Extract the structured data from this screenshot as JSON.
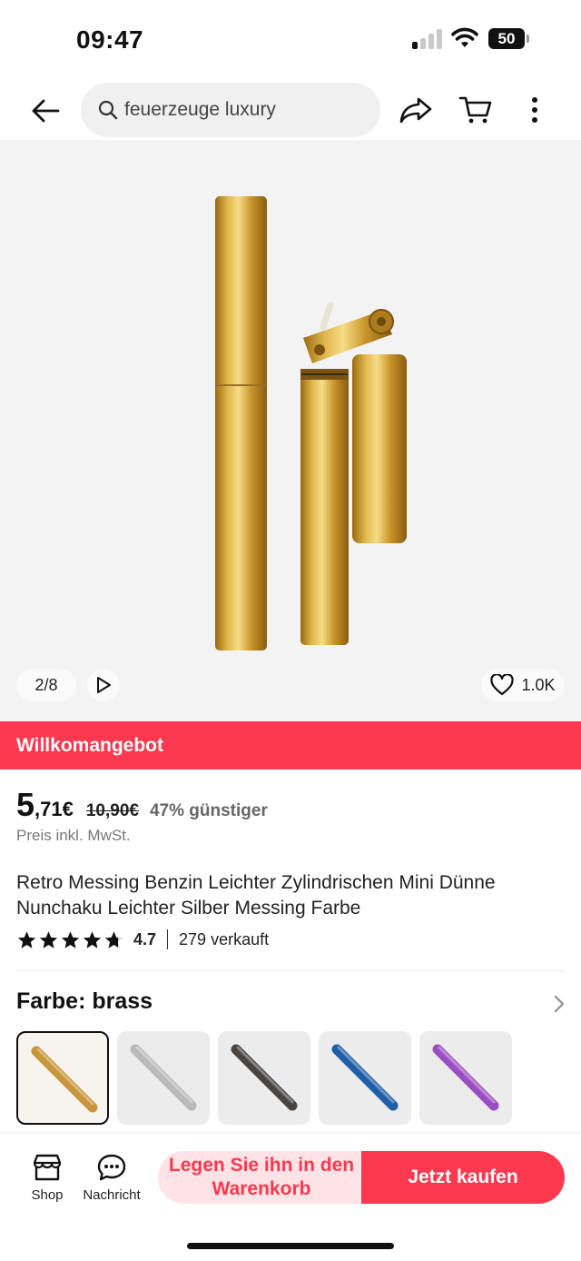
{
  "status_bar": {
    "time": "09:47",
    "battery": "50"
  },
  "nav": {
    "search_text": "feuerzeuge luxury",
    "icons": [
      "back-arrow-icon",
      "search-icon",
      "share-icon",
      "cart-icon",
      "more-vertical-icon"
    ]
  },
  "gallery": {
    "page_counter": "2/8",
    "likes": "1.0K"
  },
  "banner": {
    "label": "Willkomangebot",
    "color": "#fd384f"
  },
  "price": {
    "integer": "5",
    "decimal": ",71€",
    "original": "10,90€",
    "discount": "47% günstiger",
    "tax_note": "Preis inkl. MwSt."
  },
  "product": {
    "title": "Retro Messing Benzin Leichter Zylindrischen Mini Dünne Nunchaku Leichter Silber Messing Farbe",
    "rating": "4.7",
    "rating_fraction": 0.94,
    "sold": "279 verkauft"
  },
  "variants": {
    "heading": "Farbe: brass",
    "selected_index": 0,
    "options": [
      {
        "color": "#c8953a"
      },
      {
        "color": "#b9b9b9"
      },
      {
        "color": "#4a4440"
      },
      {
        "color": "#1f5fa8"
      },
      {
        "color": "#9a4fc0"
      }
    ]
  },
  "bottom_bar": {
    "shop_label": "Shop",
    "message_label": "Nachricht",
    "add_to_cart_label": "Legen Sie ihn in den Warenkorb",
    "buy_now_label": "Jetzt kaufen"
  }
}
